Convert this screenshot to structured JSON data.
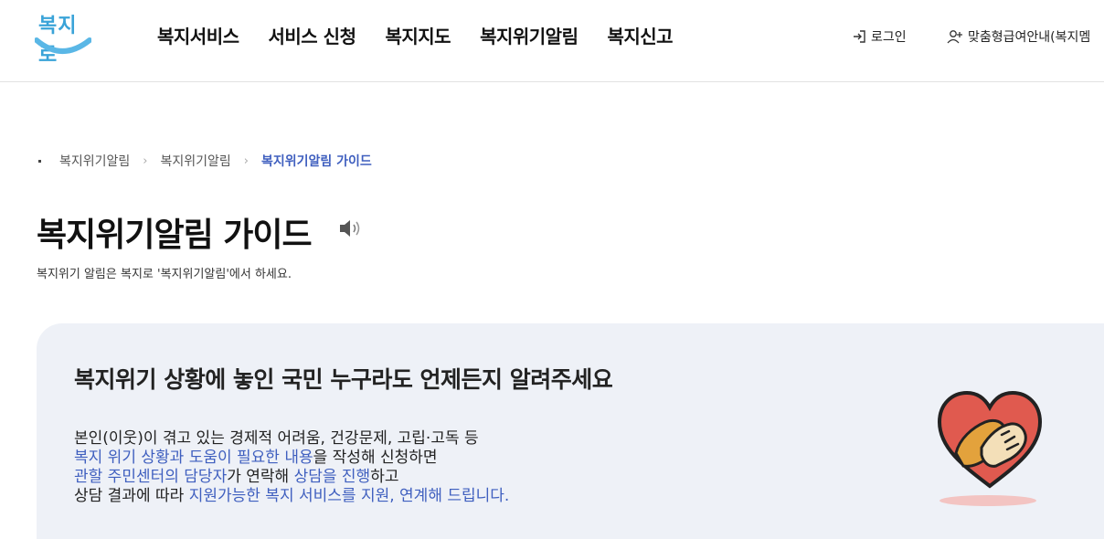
{
  "header": {
    "logo_text": "복지로",
    "nav": [
      {
        "label": "복지서비스"
      },
      {
        "label": "서비스 신청"
      },
      {
        "label": "복지지도"
      },
      {
        "label": "복지위기알림"
      },
      {
        "label": "복지신고"
      }
    ],
    "login_label": "로그인",
    "custom_guide_label": "맞춤형급여안내(복지멤"
  },
  "breadcrumb": {
    "items": [
      "복지위기알림",
      "복지위기알림",
      "복지위기알림 가이드"
    ]
  },
  "page": {
    "title": "복지위기알림 가이드",
    "description": "복지위기 알림은 복지로 '복지위기알림'에서 하세요."
  },
  "panel": {
    "title": "복지위기 상황에 놓인 국민 누구라도 언제든지 알려주세요",
    "line1": "본인(이웃)이 겪고 있는 경제적 어려움, 건강문제, 고립·고독 등",
    "line2_hl": "복지 위기 상황과 도움이 필요한 내용",
    "line2_rest": "을 작성해 신청하면",
    "line3_hl1": "관할 주민센터의 담당자",
    "line3_mid": "가 연락해 ",
    "line3_hl2": "상담을 진행",
    "line3_rest": "하고",
    "line4_pre": "상담 결과에 따라 ",
    "line4_hl": "지원가능한 복지 서비스를 지원, 연계해 드립니다."
  },
  "colors": {
    "accent": "#3f5fbf",
    "logo": "#3aa3d8",
    "panel_bg": "#eef1f7",
    "heart": "#e05a4f"
  },
  "icons": {
    "login": "login-icon",
    "user_add": "user-add-icon",
    "speaker": "speaker-icon",
    "chevron": "chevron-right-icon",
    "illustration": "heart-hands-icon"
  }
}
